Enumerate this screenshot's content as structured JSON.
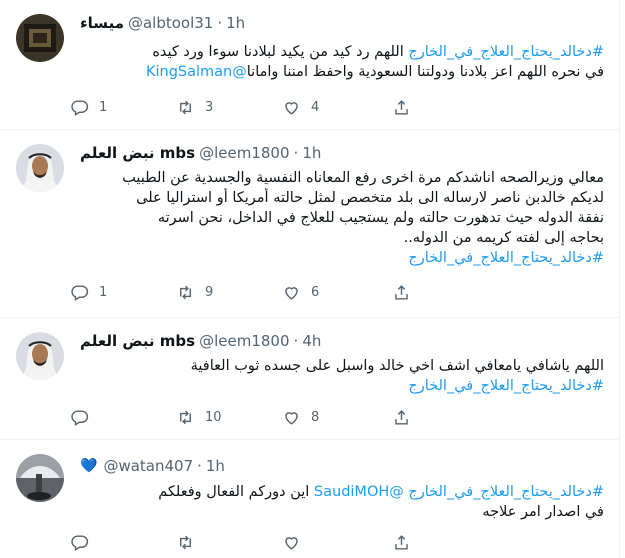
{
  "tweets": [
    {
      "display_name": "ميساء",
      "handle": "@albtool31",
      "separator": "·",
      "time": "1h",
      "lines": [
        [
          {
            "t": "#دخالد_يحتاج_العلاج_في_الخارج",
            "link": true
          },
          {
            "t": " اللهم رد كيد من يكيد لبلادنا سوءا ورد كيده",
            "link": false
          }
        ],
        [
          {
            "t": "في نحره اللهم اعز بلادنا ودولتنا السعودية واحفظ امننا وامانا",
            "link": false
          },
          {
            "t": "@KingSalman",
            "link": true
          }
        ]
      ],
      "replies": "1",
      "retweets": "3",
      "likes": "4"
    },
    {
      "display_name": "نبض العلم mbs",
      "handle": "@leem1800",
      "separator": "·",
      "time": "1h",
      "lines": [
        [
          {
            "t": "معالي وزيرالصحه اناشدكم مرة اخرى رفع المعاناه النفسية والجسدية عن الطبيب",
            "link": false
          }
        ],
        [
          {
            "t": "لديكم خالدبن ناصر لارساله الى بلد متخصص لمثل حالته أمريكا أو استراليا على",
            "link": false
          }
        ],
        [
          {
            "t": "نفقة الدوله حيث تدهورت حالته ولم يستجيب للعلاج في الداخل، نحن اسرته",
            "link": false
          }
        ],
        [
          {
            "t": "بحاجه إلى لفته كريمه من الدوله..",
            "link": false
          }
        ],
        [
          {
            "t": "#دخالد_يحتاج_العلاج_في_الخارج",
            "link": true
          }
        ]
      ],
      "replies": "1",
      "retweets": "9",
      "likes": "6"
    },
    {
      "display_name": "نبض العلم mbs",
      "handle": "@leem1800",
      "separator": "·",
      "time": "4h",
      "lines": [
        [
          {
            "t": "اللهم ياشافي يامعافي اشف اخي خالد واسبل على جسده ثوب العافية",
            "link": false
          }
        ],
        [
          {
            "t": "#دخالد_يحتاج_العلاج_في_الخارج",
            "link": true
          }
        ]
      ],
      "replies": "",
      "retweets": "10",
      "likes": "8"
    },
    {
      "display_name": "",
      "handle": "@watan407",
      "separator": "·",
      "time": "1h",
      "lines": [
        [
          {
            "t": "#دخالد_يحتاج_العلاج_في_الخارج",
            "link": true
          },
          {
            "t": " ",
            "link": false
          },
          {
            "t": "@SaudiMOH",
            "link": true
          },
          {
            "t": " اين دوركم الفعال وفعلكم",
            "link": false
          }
        ],
        [
          {
            "t": "في اصدار امر علاجه",
            "link": false
          }
        ]
      ],
      "replies": "",
      "retweets": "",
      "likes": ""
    }
  ],
  "icons": {
    "reply": "reply-icon",
    "retweet": "retweet-icon",
    "like": "heart-icon",
    "share": "share-icon",
    "badge": "blue-heart-icon"
  },
  "colors": {
    "link": "#1d9bf0",
    "muted": "#536471",
    "text": "#0f1419",
    "divider": "#eff3f4"
  }
}
